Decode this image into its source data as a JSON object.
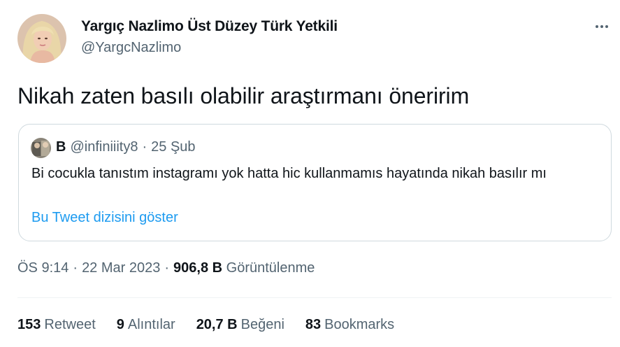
{
  "author": {
    "display_name": "Yargıç Nazlimo Üst Düzey Türk Yetkili",
    "handle": "@YargcNazlimo"
  },
  "tweet": {
    "text": "Nikah zaten basılı olabilir araştırmanı öneririm"
  },
  "quoted": {
    "name": "B",
    "handle": "@infiniiity8",
    "separator": "·",
    "date": "25 Şub",
    "text": "Bi cocukla tanıstım instagramı yok hatta hic kullanmamıs hayatında nikah basılır mı",
    "show_thread": "Bu Tweet dizisini göster"
  },
  "meta": {
    "time": "ÖS 9:14",
    "sep1": "·",
    "date": "22 Mar 2023",
    "sep2": "·",
    "views_count": "906,8 B",
    "views_label": "Görüntülenme"
  },
  "stats": [
    {
      "count": "153",
      "label": "Retweet"
    },
    {
      "count": "9",
      "label": "Alıntılar"
    },
    {
      "count": "20,7 B",
      "label": "Beğeni"
    },
    {
      "count": "83",
      "label": "Bookmarks"
    }
  ],
  "icons": {
    "more": "more-horizontal-icon"
  },
  "colors": {
    "text": "#0f1419",
    "secondary": "#536471",
    "link": "#1d9bf0",
    "border": "#cfd9de"
  }
}
